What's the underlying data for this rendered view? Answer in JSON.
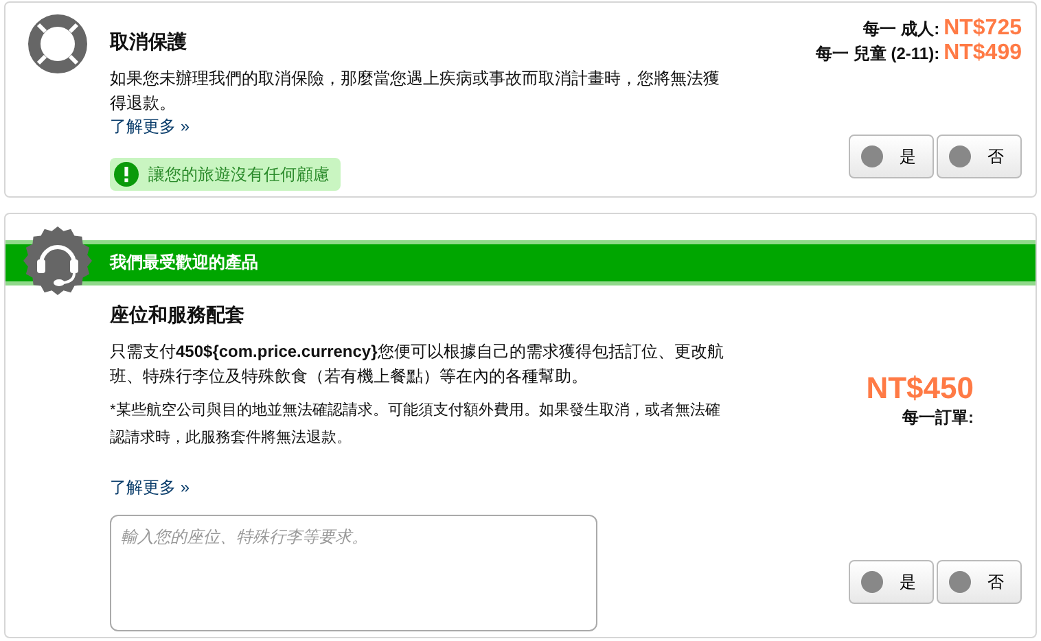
{
  "cards": [
    {
      "kind": "insurance",
      "title": "取消保護",
      "description": "如果您未辦理我們的取消保險，那麼當您遇上疾病或事故而取消計畫時，您將無法獲得退款。",
      "link": "了解更多 »",
      "notice": "讓您的旅遊沒有任何顧慮",
      "prices": [
        {
          "label": "每一 成人:",
          "value": "NT$725"
        },
        {
          "label": "每一 兒童 (2-11):",
          "value": "NT$499"
        }
      ],
      "options": [
        {
          "label": "是",
          "selected": false
        },
        {
          "label": "否",
          "selected": false
        }
      ]
    },
    {
      "kind": "service",
      "banner": "我們最受歡迎的產品",
      "title": "座位和服務配套",
      "description": "只需支付**450${com.price.currency}**您便可以根據自己的需求獲得包括訂位、更改航班、特殊行李位及特殊飲食（若有機上餐點）等在內的各種幫助。",
      "note": "*某些航空公司與目的地並無法確認請求。可能須支付額外費用。如果發生取消，或者無法確認請求時，此服務套件將無法退款。",
      "link": "了解更多 »",
      "request": {
        "placeholder": "輸入您的座位、特殊行李等要求。"
      },
      "price": {
        "value": "NT$450",
        "label": "每一訂單:"
      },
      "options": [
        {
          "label": "是",
          "selected": false
        },
        {
          "label": "否",
          "selected": false
        }
      ]
    }
  ]
}
